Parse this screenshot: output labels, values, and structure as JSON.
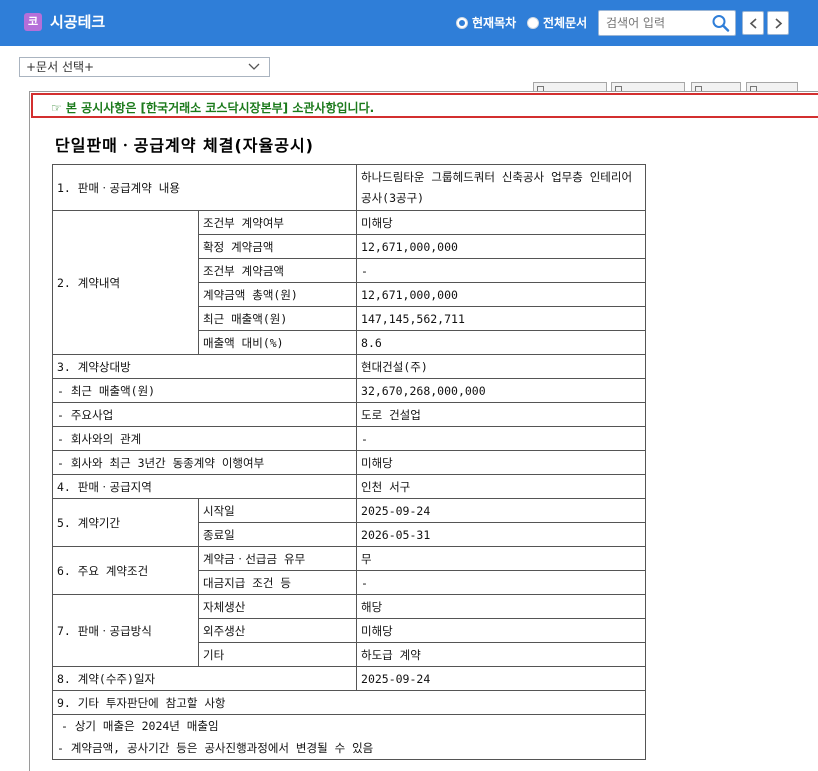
{
  "app": {
    "logo_char": "코",
    "title": "시공테크"
  },
  "search_scope": {
    "current_label": "현재목차",
    "all_label": "전체문서",
    "selected": "current"
  },
  "search": {
    "placeholder": "검색어 입력"
  },
  "doc_select": {
    "value": "+문서 선택+"
  },
  "notice": {
    "text": "☞ 본 공시사항은 [한국거래소 코스닥시장본부] 소관사항입니다."
  },
  "document": {
    "title": "단일판매ㆍ공급계약 체결(자율공시)",
    "rows": {
      "contract_content_label": "1. 판매ㆍ공급계약 내용",
      "contract_content_value": "하나드림타운 그룹헤드쿼터 신축공사 업무층 인테리어공사(3공구)",
      "contract_details_label": "2. 계약내역",
      "conditional_flag_label": "조건부 계약여부",
      "conditional_flag_value": "미해당",
      "confirmed_amount_label": "확정 계약금액",
      "confirmed_amount_value": "12,671,000,000",
      "conditional_amount_label": "조건부 계약금액",
      "conditional_amount_value": "-",
      "total_amount_label": "계약금액 총액(원)",
      "total_amount_value": "12,671,000,000",
      "recent_sales_label": "최근 매출액(원)",
      "recent_sales_value": "147,145,562,711",
      "sales_ratio_label": "매출액 대비(%)",
      "sales_ratio_value": "8.6",
      "counterparty_label": "3. 계약상대방",
      "counterparty_value": "현대건설(주)",
      "cp_recent_sales_label": "- 최근 매출액(원)",
      "cp_recent_sales_value": "32,670,268,000,000",
      "cp_main_business_label": "- 주요사업",
      "cp_main_business_value": "도로 건설업",
      "cp_relation_label": "- 회사와의 관계",
      "cp_relation_value": "-",
      "cp_history_label": "- 회사와 최근 3년간 동종계약 이행여부",
      "cp_history_value": "미해당",
      "region_label": "4. 판매ㆍ공급지역",
      "region_value": "인천 서구",
      "period_label": "5. 계약기간",
      "start_label": "시작일",
      "start_value": "2025-09-24",
      "end_label": "종료일",
      "end_value": "2026-05-31",
      "terms_label": "6. 주요 계약조건",
      "advance_label": "계약금ㆍ선급금 유무",
      "advance_value": "무",
      "payment_label": "대금지급 조건 등",
      "payment_value": "-",
      "supply_method_label": "7. 판매ㆍ공급방식",
      "self_production_label": "자체생산",
      "self_production_value": "해당",
      "outsourcing_label": "외주생산",
      "outsourcing_value": "미해당",
      "other_label": "기타",
      "other_value": "하도급 계약",
      "contract_date_label": "8. 계약(수주)일자",
      "contract_date_value": "2025-09-24",
      "other_matters_label": "9. 기타 투자판단에 참고할 사항",
      "note_1": "- 상기 매출은 2024년 매출임",
      "note_2": "- 계약금액, 공사기간 등은 공사진행과정에서 변경될 수 있음"
    }
  },
  "colors": {
    "header_bg": "#2f7ed8",
    "logo_bg": "#b56fd9",
    "notice_border": "#d32f2f",
    "notice_text": "#1b7a1b"
  }
}
